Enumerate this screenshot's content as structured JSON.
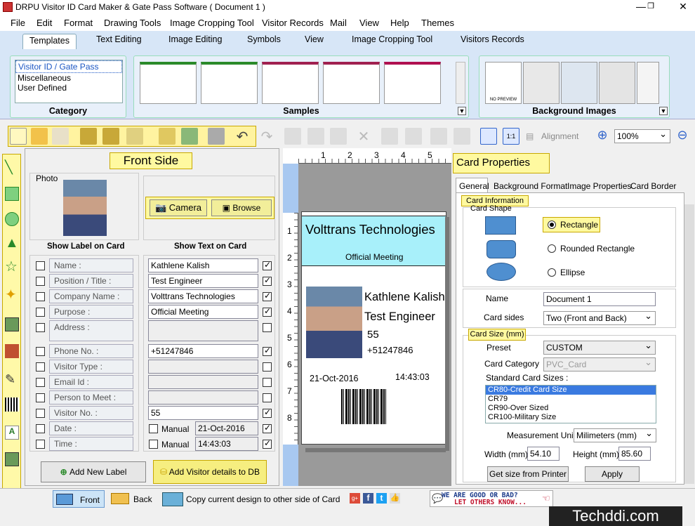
{
  "window": {
    "title": "DRPU Visitor ID Card Maker & Gate Pass Software ( Document 1 )"
  },
  "menu": [
    "File",
    "Edit",
    "Format",
    "Drawing Tools",
    "Image Cropping Tool",
    "Visitor Records",
    "Mail",
    "View",
    "Help",
    "Themes"
  ],
  "ribbon_tabs": [
    "Templates",
    "Text Editing",
    "Image Editing",
    "Symbols",
    "View",
    "Image Cropping Tool",
    "Visitors Records"
  ],
  "category": {
    "caption": "Category",
    "items": [
      "Visitor ID / Gate Pass",
      "Miscellaneous",
      "User Defined"
    ],
    "selected": 0
  },
  "samples": {
    "caption": "Samples"
  },
  "background": {
    "caption": "Background Images",
    "no_preview": "NO PREVIEW"
  },
  "toolbar": {
    "alignment": "Alignment",
    "zoom": "100%"
  },
  "front": {
    "title": "Front Side",
    "photo_label": "Photo",
    "camera": "Camera",
    "browse": "Browse",
    "show_label": "Show Label on Card",
    "show_text": "Show Text on Card",
    "rows": [
      {
        "label": "Name :",
        "value": "Kathlene Kalish",
        "lchk": false,
        "rchk": true
      },
      {
        "label": "Position / Title :",
        "value": "Test Engineer",
        "lchk": false,
        "rchk": true
      },
      {
        "label": "Company Name :",
        "value": "Volttrans Technologies",
        "lchk": false,
        "rchk": true
      },
      {
        "label": "Purpose :",
        "value": "Official Meeting",
        "lchk": false,
        "rchk": true
      },
      {
        "label": "Address :",
        "value": "",
        "lchk": false,
        "rchk": false
      },
      {
        "label": "Phone No. :",
        "value": "+51247846",
        "lchk": false,
        "rchk": true
      },
      {
        "label": "Visitor Type :",
        "value": "",
        "lchk": false,
        "rchk": false
      },
      {
        "label": "Email Id :",
        "value": "",
        "lchk": false,
        "rchk": false
      },
      {
        "label": "Person to Meet :",
        "value": "",
        "lchk": false,
        "rchk": false
      },
      {
        "label": "Visitor No. :",
        "value": "55",
        "lchk": false,
        "rchk": true
      },
      {
        "label": "Date :",
        "value": "21-Oct-2016",
        "lchk": false,
        "rchk": true,
        "manual": "Manual"
      },
      {
        "label": "Time :",
        "value": "14:43:03",
        "lchk": false,
        "rchk": true,
        "manual": "Manual"
      }
    ],
    "add_label": "Add New Label",
    "add_db": "Add Visitor details to DB"
  },
  "ruler": {
    "top": [
      "1",
      "2",
      "3",
      "4",
      "5"
    ],
    "left": [
      "1",
      "2",
      "3",
      "4",
      "5",
      "6",
      "7",
      "8"
    ]
  },
  "card": {
    "company": "Volttrans Technologies",
    "purpose": "Official Meeting",
    "name": "Kathlene Kalish",
    "title": "Test Engineer",
    "number": "55",
    "phone": "+51247846",
    "date": "21-Oct-2016",
    "time": "14:43:03"
  },
  "props": {
    "title": "Card Properties",
    "tabs": [
      "General",
      "Background Format",
      "Image Properties",
      "Card Border"
    ],
    "card_info": "Card Information",
    "card_shape": "Card Shape",
    "shapes": [
      "Rectangle",
      "Rounded Rectangle",
      "Ellipse"
    ],
    "name_label": "Name",
    "name_value": "Document 1",
    "sides_label": "Card sides",
    "sides_value": "Two (Front and Back)",
    "size_title": "Card Size (mm)",
    "preset_label": "Preset",
    "preset_value": "CUSTOM",
    "category_label": "Card Category",
    "category_value": "PVC_Card",
    "std_label": "Standard Card Sizes :",
    "std_items": [
      "CR80-Credit Card Size",
      "CR79",
      "CR90-Over Sized",
      "CR100-Military Size"
    ],
    "unit_label": "Measurement Unit :",
    "unit_value": "Milimeters (mm)",
    "width_label": "Width  (mm)",
    "width_value": "54.10",
    "height_label": "Height  (mm)",
    "height_value": "85.60",
    "printer_btn": "Get size from Printer",
    "apply_btn": "Apply"
  },
  "status": {
    "front": "Front",
    "back": "Back",
    "copy": "Copy current design to other side of Card",
    "feedback1": "WE ARE GOOD OR BAD?",
    "feedback2": "LET OTHERS KNOW..."
  },
  "watermark": "Techddi.com"
}
